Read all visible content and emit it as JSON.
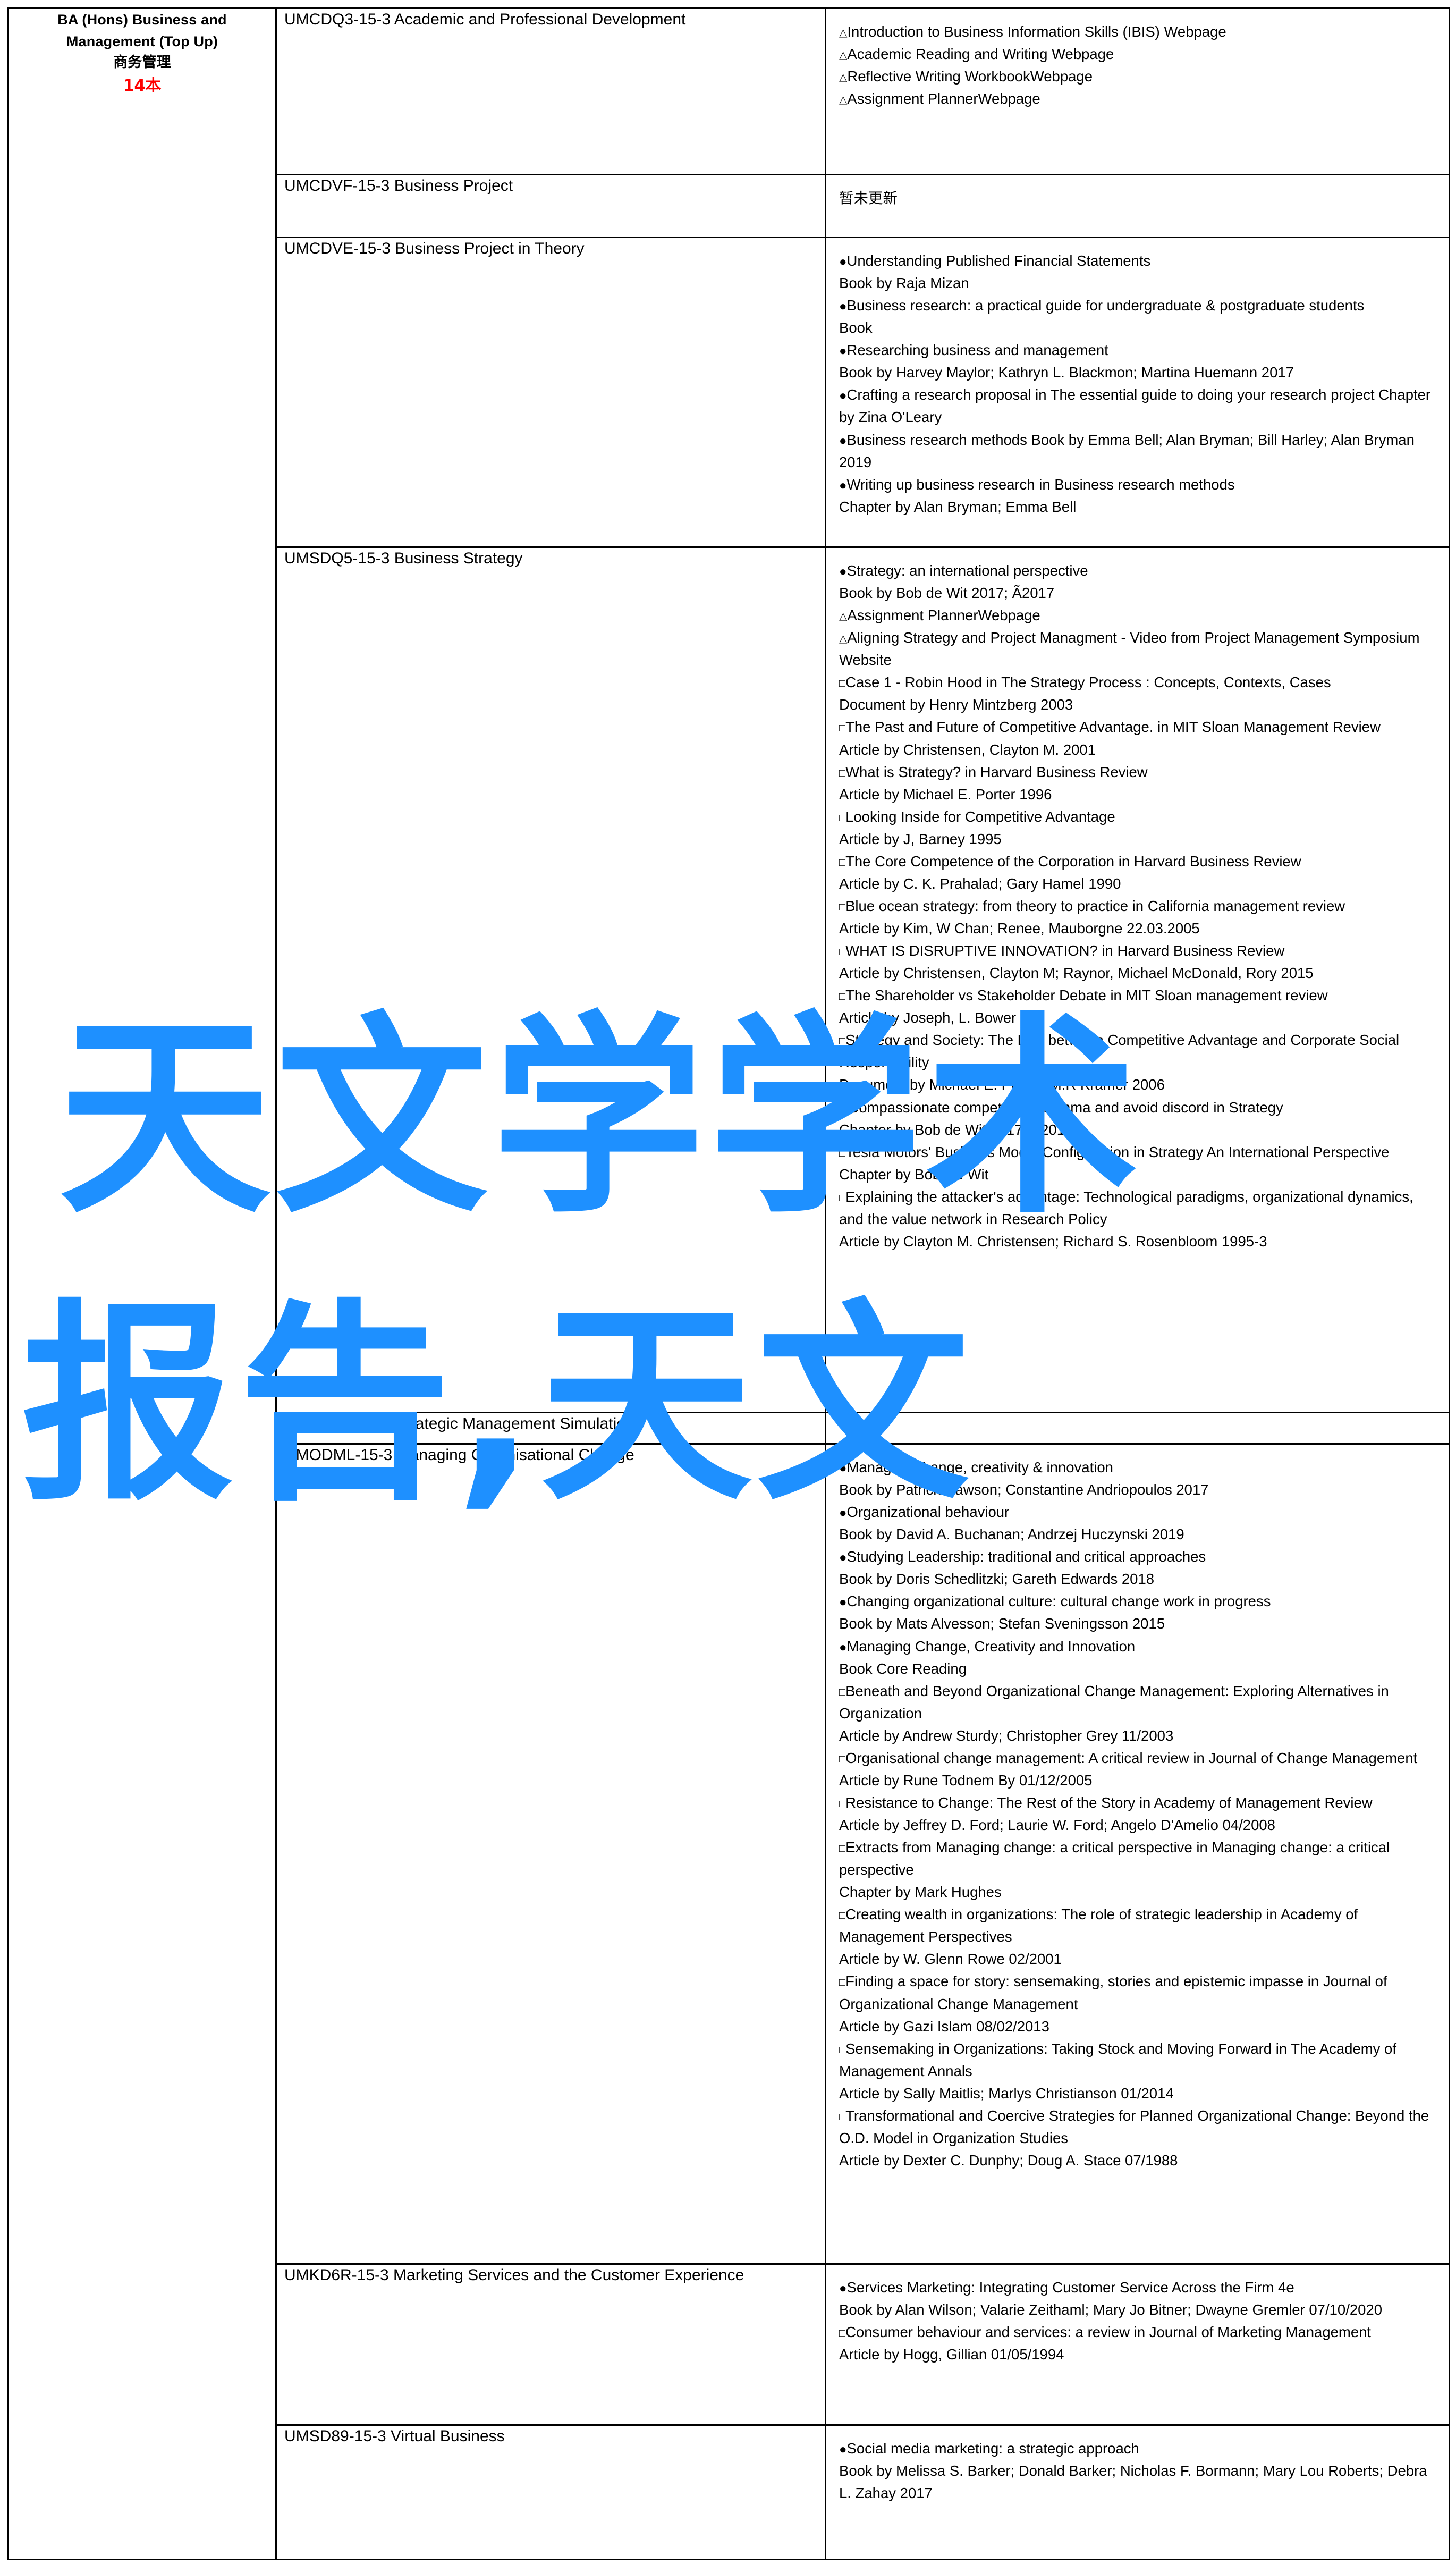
{
  "document": {
    "type": "reading-list-table",
    "watermark": {
      "color": "#1e90ff",
      "line1": "天文学学术",
      "line2": "报告,天文"
    },
    "program": {
      "name_en_line1": "BA (Hons) Business and",
      "name_en_line2": "Management (Top Up)",
      "name_cn": "商务管理",
      "count": "14本"
    }
  },
  "rows": [
    {
      "module": "UMCDQ3-15-3 Academic and Professional Development",
      "resources": [
        "△Introduction to Business Information Skills (IBIS) Webpage",
        "△Academic Reading and Writing Webpage",
        "△Reflective Writing WorkbookWebpage",
        "△Assignment PlannerWebpage"
      ]
    },
    {
      "module": "UMCDVF-15-3 Business Project",
      "resources": [
        "暂未更新"
      ]
    },
    {
      "module": "UMCDVE-15-3 Business Project in Theory",
      "resources": [
        "●Understanding Published Financial Statements",
        "Book  by Raja Mizan",
        "●Business research: a practical guide for undergraduate & postgraduate students",
        "Book",
        "●Researching business and management",
        "Book  by Harvey Maylor; Kathryn L. Blackmon; Martina Huemann 2017",
        "●Crafting a research proposal in The essential guide to doing your research project Chapter  by Zina O'Leary",
        "●Business research methods Book  by Emma Bell; Alan Bryman; Bill Harley; Alan Bryman 2019",
        "●Writing up business research in Business research methods",
        "Chapter  by Alan Bryman; Emma Bell"
      ]
    },
    {
      "module": "UMSDQ5-15-3 Business Strategy",
      "resources": [
        "●Strategy: an international perspective",
        "Book  by Bob de Wit 2017; Ã2017",
        "△Assignment PlannerWebpage",
        "△Aligning Strategy and Project Managment - Video from Project Management Symposium",
        "Website",
        "□Case 1 - Robin Hood in The Strategy Process : Concepts, Contexts, Cases",
        "Document  by Henry Mintzberg 2003",
        "□The Past and Future of Competitive Advantage. in MIT Sloan Management Review",
        "Article  by Christensen, Clayton M. 2001",
        "□What is Strategy? in Harvard Business Review",
        "Article  by Michael E. Porter 1996",
        "□Looking Inside for Competitive Advantage",
        "Article  by J, Barney 1995",
        "□The Core Competence of the Corporation in Harvard Business Review",
        "Article  by C. K. Prahalad; Gary Hamel 1990",
        "□Blue ocean strategy: from theory to practice in California management review",
        "Article  by Kim, W Chan; Renee, Mauborgne 22.03.2005",
        "□WHAT IS DISRUPTIVE INNOVATION? in Harvard Business Review",
        "Article  by Christensen, Clayton M; Raynor, Michael McDonald, Rory 2015",
        "□The Shareholder vs Stakeholder Debate in MIT Sloan management review",
        "Article  by Joseph, L. Bower",
        "□Strategy and Society: The Link between Competitive Advantage and Corporate Social Responsibility",
        "Document  by Michael E. Porter; M.R Kramer 2006",
        "□'Compassionate competition' dilemma and avoid discord in Strategy",
        "Chapter  by Bob de Wit 2017; Ã2017",
        "□Tesla Motors' Business Model Configuration in Strategy An International Perspective",
        "Chapter  by Bob De Wit",
        "□Explaining the attacker's advantage: Technological paradigms, organizational dynamics, and the value network in Research Policy",
        "Article  by Clayton M. Christensen; Richard S. Rosenbloom 1995-3"
      ]
    },
    {
      "module": "UMSDM9-15-3 Strategic Management Simulation",
      "resources": []
    },
    {
      "module": "UMODML-15-3 Managing Organisational Change",
      "resources": [
        "●Managing change, creativity & innovation",
        "Book  by Patrick Dawson; Constantine Andriopoulos 2017",
        "●Organizational behaviour",
        "Book  by David A. Buchanan; Andrzej Huczynski 2019",
        "●Studying Leadership: traditional and critical approaches",
        "Book  by Doris Schedlitzki; Gareth Edwards 2018",
        "●Changing organizational culture: cultural change work in progress",
        "Book  by Mats Alvesson; Stefan Sveningsson 2015",
        "●Managing Change, Creativity and Innovation",
        "Book  Core Reading",
        "□Beneath and Beyond Organizational Change Management: Exploring Alternatives in Organization",
        "Article  by Andrew Sturdy; Christopher Grey 11/2003",
        "□Organisational change management: A critical review in Journal of Change Management",
        "Article  by Rune Todnem By 01/12/2005",
        "□Resistance to Change: The Rest of the Story in Academy of Management Review",
        "Article  by Jeffrey D. Ford; Laurie W. Ford; Angelo D'Amelio 04/2008",
        "□Extracts from Managing change: a critical perspective in Managing change: a critical perspective",
        "Chapter  by Mark Hughes",
        "□Creating wealth in organizations: The role of strategic leadership in Academy of Management Perspectives",
        "Article  by W. Glenn Rowe 02/2001",
        "□Finding a space for story: sensemaking, stories and epistemic impasse in Journal of Organizational Change Management",
        "Article  by Gazi Islam 08/02/2013",
        "□Sensemaking in Organizations: Taking Stock and Moving Forward in The Academy of Management Annals",
        "Article  by Sally Maitlis; Marlys Christianson 01/2014",
        "□Transformational and Coercive Strategies for Planned Organizational Change: Beyond the O.D. Model in Organization Studies",
        "Article  by Dexter C. Dunphy; Doug A. Stace 07/1988"
      ]
    },
    {
      "module": "UMKD6R-15-3 Marketing Services and the Customer Experience",
      "resources": [
        "●Services Marketing: Integrating Customer Service Across the Firm 4e",
        "Book  by Alan Wilson; Valarie Zeithaml; Mary Jo Bitner; Dwayne Gremler 07/10/2020",
        "□Consumer behaviour and services: a review in Journal of Marketing Management",
        "Article  by Hogg, Gillian 01/05/1994"
      ]
    },
    {
      "module": "UMSD89-15-3 Virtual Business",
      "resources": [
        "●Social media marketing: a strategic approach",
        "Book  by Melissa S. Barker; Donald Barker; Nicholas F. Bormann; Mary Lou Roberts; Debra L. Zahay 2017"
      ]
    }
  ]
}
